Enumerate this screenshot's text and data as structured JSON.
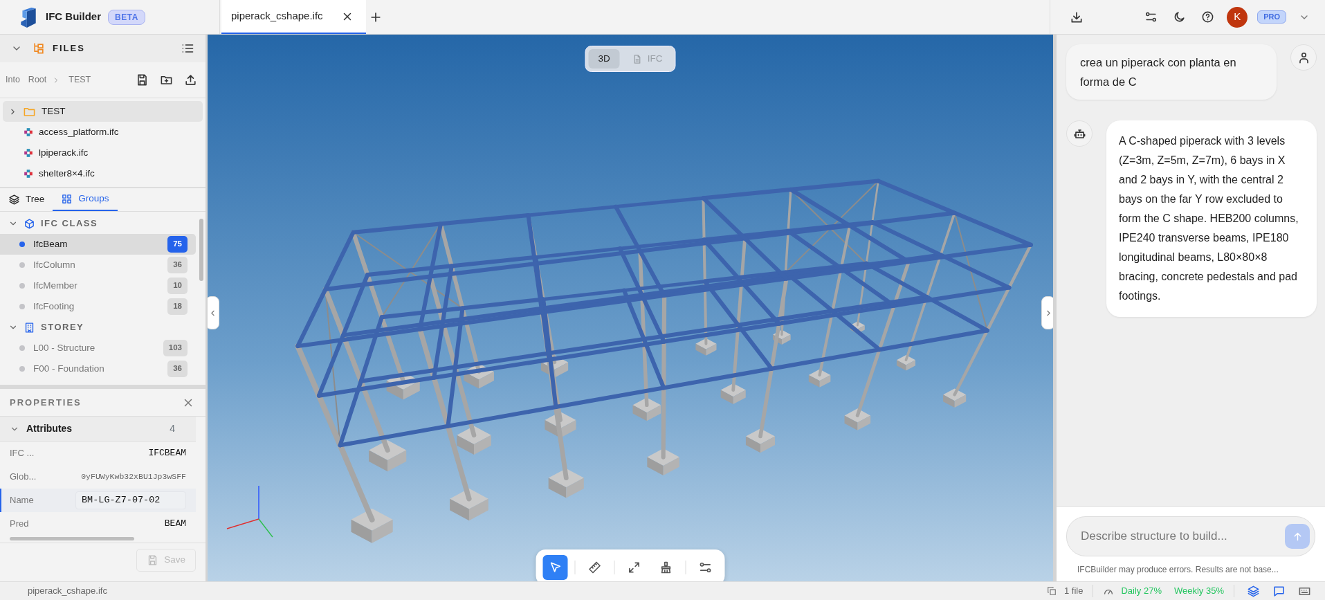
{
  "app": {
    "name": "IFC Builder",
    "badge": "BETA"
  },
  "tabs": [
    {
      "label": "piperack_cshape.ifc",
      "selected": true
    }
  ],
  "user": {
    "initial": "K",
    "plan": "PRO"
  },
  "files": {
    "title": "FILES",
    "breadcrumb_label": "Into",
    "path": [
      "Root",
      "TEST"
    ],
    "items": [
      {
        "name": "TEST",
        "kind": "folder",
        "selected": true
      },
      {
        "name": "access_platform.ifc",
        "kind": "file",
        "selected": false
      },
      {
        "name": "lpiperack.ifc",
        "kind": "file",
        "selected": false
      },
      {
        "name": "shelter8×4.ifc",
        "kind": "file",
        "selected": false
      }
    ]
  },
  "panel_tabs": [
    {
      "label": "Tree",
      "kind": "tree",
      "selected": false
    },
    {
      "label": "Groups",
      "kind": "groups",
      "selected": true
    }
  ],
  "groups": [
    {
      "title": "IFC CLASS",
      "kind": "class",
      "expanded": true,
      "items": [
        {
          "name": "IfcBeam",
          "count": "75",
          "selected": true
        },
        {
          "name": "IfcColumn",
          "count": "36",
          "selected": false
        },
        {
          "name": "IfcMember",
          "count": "10",
          "selected": false
        },
        {
          "name": "IfcFooting",
          "count": "18",
          "selected": false
        }
      ]
    },
    {
      "title": "STOREY",
      "kind": "storey",
      "expanded": true,
      "items": [
        {
          "name": "L00 - Structure",
          "count": "103",
          "selected": false
        },
        {
          "name": "F00 - Foundation",
          "count": "36",
          "selected": false
        }
      ]
    }
  ],
  "properties": {
    "title": "PROPERTIES",
    "section": {
      "title": "Attributes",
      "count": "4",
      "expanded": true
    },
    "rows": [
      {
        "key": "IFC ...",
        "value": "IFCBEAM",
        "kind": "mono",
        "selected": false
      },
      {
        "key": "Glob...",
        "value": "0yFUWyKwb32xBU1Jp3wSFF",
        "kind": "id",
        "selected": false
      },
      {
        "key": "Name",
        "value": "BM-LG-Z7-07-02",
        "kind": "input",
        "selected": true
      },
      {
        "key": "Pred",
        "value": "BEAM",
        "kind": "mono",
        "selected": false
      }
    ],
    "save": {
      "label": "Save",
      "disabled": true
    }
  },
  "view_modes": [
    {
      "label": "3D",
      "kind": "model",
      "selected": true
    },
    {
      "label": "IFC",
      "kind": "ifc",
      "selected": false
    }
  ],
  "tools": [
    {
      "kind": "select",
      "selected": true
    },
    {
      "kind": "measure",
      "selected": false
    },
    {
      "kind": "fit",
      "selected": false
    },
    {
      "kind": "clear",
      "selected": false
    },
    {
      "kind": "settings",
      "selected": false
    }
  ],
  "chat": {
    "messages": [
      {
        "kind": "user",
        "text": "crea un piperack con planta en forma de C"
      },
      {
        "kind": "bot",
        "text": "A C-shaped piperack with 3 levels (Z=3m, Z=5m, Z=7m), 6 bays in X and 2 bays in Y, with the central 2 bays on the far Y row excluded to form the C shape. HEB200 columns, IPE240 transverse beams, IPE180 longitudinal beams, L80×80×8 bracing, concrete pedestals and pad footings."
      }
    ],
    "placeholder": "Describe structure to build...",
    "disclaimer": "IFCBuilder may produce errors. Results are not base..."
  },
  "status_bar": {
    "file_name": "piperack_cshape.ifc",
    "files": "1 file",
    "daily": "Daily 27%",
    "weekly": "Weekly 35%"
  }
}
